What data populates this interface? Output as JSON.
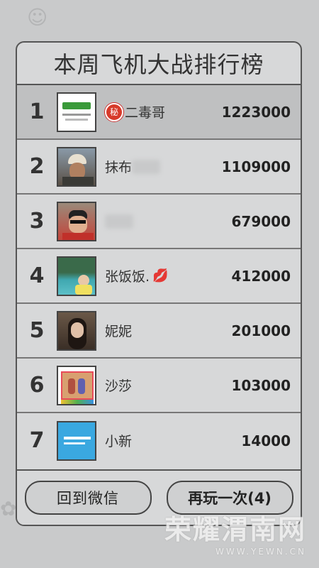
{
  "title": "本周飞机大战排行榜",
  "rows": [
    {
      "rank": "1",
      "name": "二毒哥",
      "score": "1223000",
      "badge": "秘"
    },
    {
      "rank": "2",
      "name": "抹布",
      "score": "1109000"
    },
    {
      "rank": "3",
      "name": "",
      "score": "679000"
    },
    {
      "rank": "4",
      "name": "张饭饭.",
      "score": "412000",
      "emoji": "💋"
    },
    {
      "rank": "5",
      "name": "妮妮",
      "score": "201000"
    },
    {
      "rank": "6",
      "name": "沙莎",
      "score": "103000"
    },
    {
      "rank": "7",
      "name": "小新",
      "score": "14000"
    }
  ],
  "buttons": {
    "back": "回到微信",
    "replay": "再玩一次(4)"
  },
  "watermark": {
    "line1": "荣耀渭南网",
    "line2": "WWW.YEWN.CN"
  },
  "colors": {
    "background": "#c9cacb",
    "panel": "#d7d8d9",
    "highlight": "#bfc0c1",
    "badge": "#d73a2a"
  }
}
